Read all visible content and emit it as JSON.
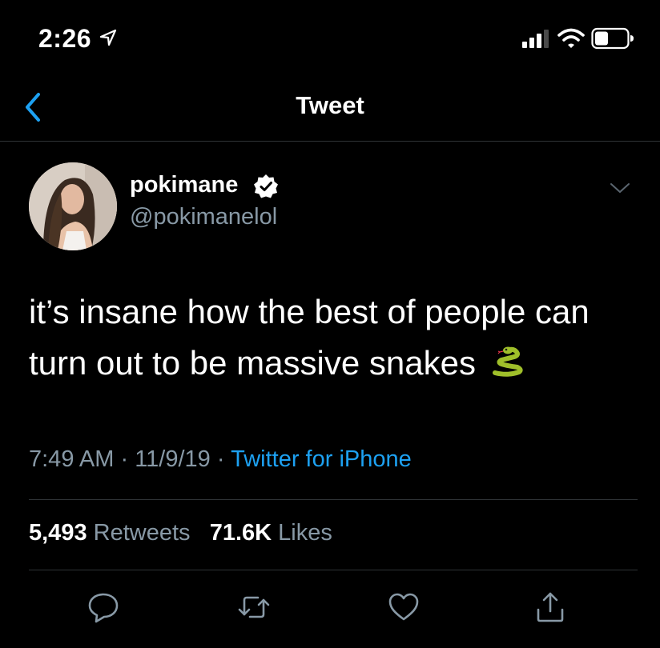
{
  "status_bar": {
    "time": "2:26",
    "icons": [
      "location-arrow-icon",
      "cellular-signal-icon",
      "wifi-icon",
      "battery-icon"
    ]
  },
  "nav": {
    "title": "Tweet",
    "back_icon": "chevron-left-icon"
  },
  "tweet": {
    "author_name": "pokimane",
    "author_handle": "@pokimanelol",
    "verified": true,
    "text_line1": "it’s insane how the best of people can",
    "text_line2": "turn out to be massive snakes",
    "emoji": "snake",
    "time": "7:49 AM",
    "date": "11/9/19",
    "separator": "·",
    "source": "Twitter for iPhone",
    "retweets_count": "5,493",
    "retweets_label": "Retweets",
    "likes_count": "71.6K",
    "likes_label": "Likes"
  },
  "actions": [
    "reply-icon",
    "retweet-icon",
    "like-icon",
    "share-icon"
  ],
  "colors": {
    "background": "#000000",
    "text_primary": "#ffffff",
    "text_secondary": "#8899a6",
    "accent": "#1da1f2",
    "divider": "#2f3336"
  }
}
